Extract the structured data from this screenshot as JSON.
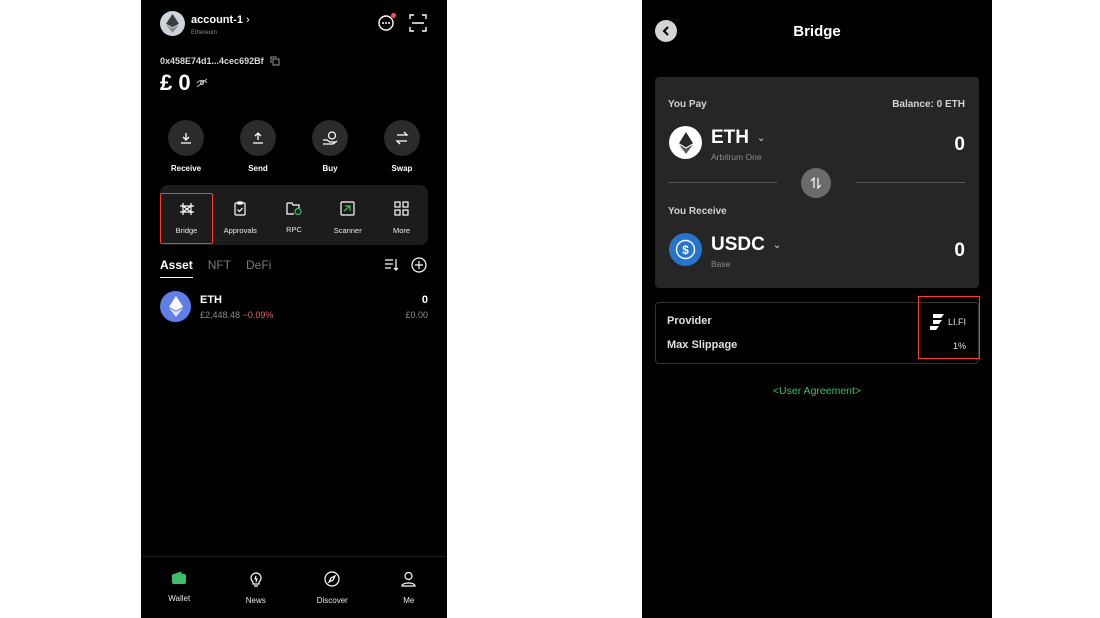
{
  "wallet": {
    "account_name": "account-1",
    "account_chevron": "›",
    "chain": "Ethereum",
    "address": "0x458E74d1...4cec692Bf",
    "balance": "£ 0",
    "actions": [
      {
        "label": "Receive",
        "icon": "download-icon"
      },
      {
        "label": "Send",
        "icon": "upload-icon"
      },
      {
        "label": "Buy",
        "icon": "buy-coin-icon"
      },
      {
        "label": "Swap",
        "icon": "swap-icon"
      }
    ],
    "tools": [
      {
        "label": "Bridge",
        "icon": "bridge-icon",
        "highlighted": true
      },
      {
        "label": "Approvals",
        "icon": "clipboard-check-icon"
      },
      {
        "label": "RPC",
        "icon": "folder-rpc-icon"
      },
      {
        "label": "Scanner",
        "icon": "scanner-icon"
      },
      {
        "label": "More",
        "icon": "grid-icon"
      }
    ],
    "asset_tabs": [
      "Asset",
      "NFT",
      "DeFi"
    ],
    "assets": [
      {
        "name": "ETH",
        "price": "£2,448.48",
        "change": "−0.09%",
        "amount": "0",
        "fiat": "£0.00"
      }
    ],
    "nav": [
      {
        "label": "Wallet",
        "icon": "wallet-icon"
      },
      {
        "label": "News",
        "icon": "lightbulb-icon"
      },
      {
        "label": "Discover",
        "icon": "compass-icon"
      },
      {
        "label": "Me",
        "icon": "user-icon"
      }
    ]
  },
  "bridge": {
    "title": "Bridge",
    "pay": {
      "label": "You Pay",
      "balance": "Balance: 0 ETH",
      "symbol": "ETH",
      "chain": "Arbitrum One",
      "amount": "0"
    },
    "receive": {
      "label": "You Receive",
      "symbol": "USDC",
      "chain": "Base",
      "amount": "0"
    },
    "provider_label": "Provider",
    "provider_name": "LI.FI",
    "slippage_label": "Max Slippage",
    "slippage_value": "1%",
    "agreement": "<User Agreement>"
  },
  "colors": {
    "accent_green": "#3fbf6a",
    "highlight_red": "#ff3b30",
    "negative": "#e0656b"
  }
}
